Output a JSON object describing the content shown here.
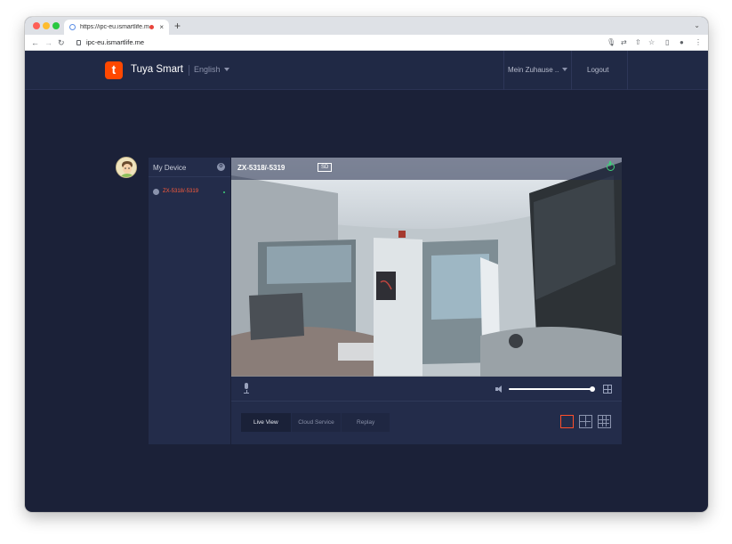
{
  "browser": {
    "tab_title": "https://ipc-eu.ismartlife.me",
    "tab_close": "×",
    "new_tab": "+",
    "tab_menu": "⌄",
    "url": "ipc-eu.ismartlife.me",
    "nav": {
      "back": "←",
      "forward": "→",
      "reload": "↻"
    },
    "toolbar_icons": {
      "mic": "🎙",
      "translate": "⇄",
      "share": "⇧",
      "bookmark": "☆",
      "sidepanel": "▯",
      "profile": "●",
      "menu": "⋮"
    }
  },
  "header": {
    "logo_letter": "t",
    "brand": "Tuya Smart",
    "language": "English",
    "home": "Mein Zuhause ..",
    "logout": "Logout"
  },
  "sidebar": {
    "title": "My Device",
    "device_name": "ZX-5318/-5319"
  },
  "player": {
    "camera_name": "ZX-5318/-5319",
    "quality": "SD",
    "volume": 1.0,
    "tabs": [
      "Live View",
      "Cloud Service",
      "Replay"
    ],
    "active_tab": "Live View",
    "active_layout": "single"
  },
  "colors": {
    "accent": "#ff4800",
    "online": "#3fd17a",
    "device_active": "#ff5c3a",
    "background": "#1b2138",
    "panel": "#232c4a"
  }
}
